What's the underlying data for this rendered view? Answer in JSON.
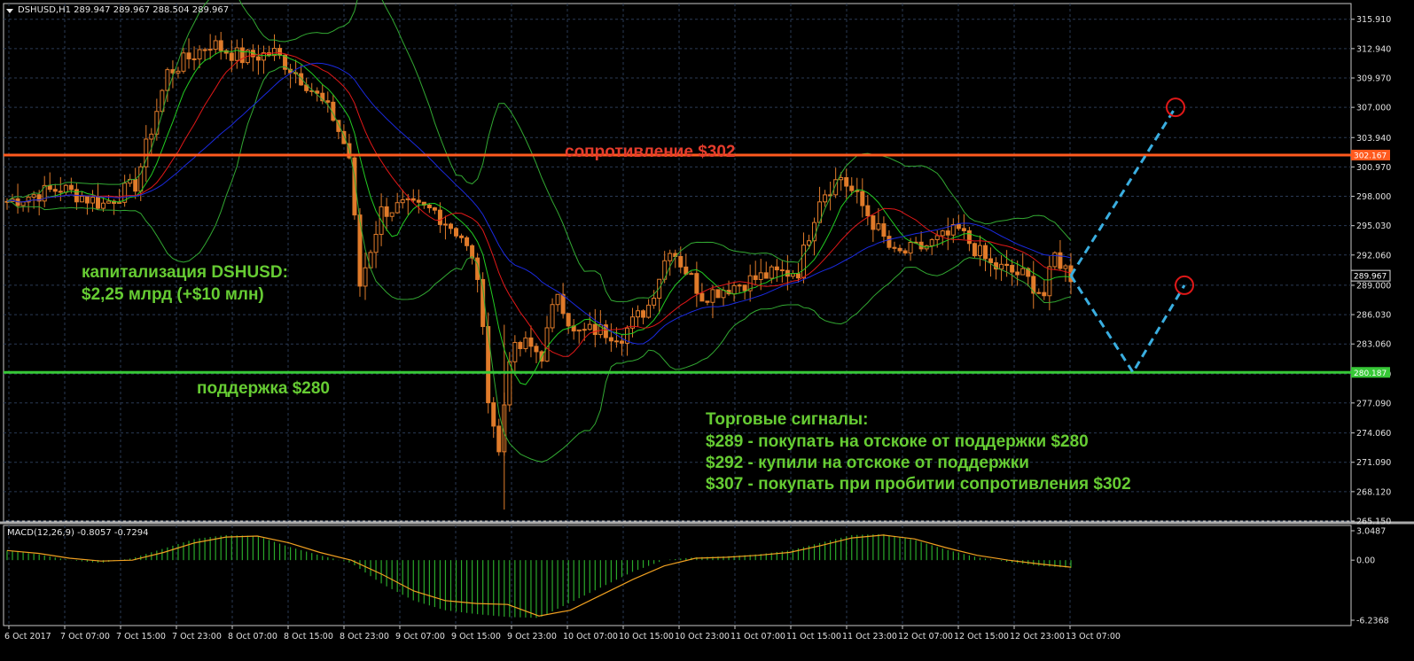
{
  "header": {
    "symbol_line": "DSHUSD,H1  289.947 289.967 288.504 289.967",
    "macd_line": "MACD(12,26,9) -0.8057 -0.7294"
  },
  "colors": {
    "background": "#000000",
    "grid": "#2a3a55",
    "axis": "#c8c8c8",
    "candle": "#e07b2a",
    "resistance": "#ff5a1e",
    "support": "#37c837",
    "annotation_green": "#66cc33",
    "annotation_red": "#e53c2c",
    "bb_band": "#32a832",
    "ma_fast": "#22cc22",
    "ma_mid": "#e01818",
    "ma_slow": "#1a2adf",
    "forecast": "#3aaee0",
    "macd_hist": "#2aa82a",
    "macd_signal": "#f0a020"
  },
  "annotations": {
    "resistance_label": "сопротивление $302",
    "support_label": "поддержка $280",
    "cap_title": "капитализация DSHUSD:",
    "cap_value": "$2,25 млрд (+$10 млн)",
    "signals_title": "Торговые сигналы:",
    "signal_1": "$289 - покупать на отскоке от поддержки $280",
    "signal_2": "$292 - купили на отскоке от поддержки",
    "signal_3": "$307 - покупать при пробитии сопротивления $302"
  },
  "chart_data": [
    {
      "type": "candlestick",
      "symbol": "DSHUSD",
      "timeframe": "H1",
      "ylim": [
        265.15,
        317.5
      ],
      "y_ticks": [
        "315.910",
        "312.940",
        "309.970",
        "307.000",
        "303.940",
        "300.970",
        "298.000",
        "295.030",
        "292.060",
        "289.000",
        "286.030",
        "283.060",
        "280.030",
        "277.090",
        "274.060",
        "271.090",
        "268.120",
        "265.150"
      ],
      "x_ticks": [
        "6 Oct 2017",
        "7 Oct 07:00",
        "7 Oct 15:00",
        "7 Oct 23:00",
        "8 Oct 07:00",
        "8 Oct 15:00",
        "8 Oct 23:00",
        "9 Oct 07:00",
        "9 Oct 15:00",
        "9 Oct 23:00",
        "10 Oct 07:00",
        "10 Oct 15:00",
        "10 Oct 23:00",
        "11 Oct 07:00",
        "11 Oct 15:00",
        "11 Oct 23:00",
        "12 Oct 07:00",
        "12 Oct 15:00",
        "12 Oct 23:00",
        "13 Oct 07:00"
      ],
      "last_price": "289.967",
      "levels": [
        {
          "name": "resistance",
          "value": 302.167,
          "label": "302.167"
        },
        {
          "name": "support",
          "value": 280.187,
          "label": "280.187"
        }
      ],
      "close_path": [
        {
          "bar": 0,
          "price": 297.5
        },
        {
          "bar": 10,
          "price": 298.8
        },
        {
          "bar": 18,
          "price": 297.2
        },
        {
          "bar": 24,
          "price": 299.2
        },
        {
          "bar": 30,
          "price": 310.5
        },
        {
          "bar": 38,
          "price": 313.5
        },
        {
          "bar": 44,
          "price": 312.0
        },
        {
          "bar": 50,
          "price": 312.5
        },
        {
          "bar": 56,
          "price": 309.5
        },
        {
          "bar": 61,
          "price": 306.0
        },
        {
          "bar": 64,
          "price": 302.0
        },
        {
          "bar": 66,
          "price": 289.0
        },
        {
          "bar": 70,
          "price": 296.5
        },
        {
          "bar": 74,
          "price": 297.0
        },
        {
          "bar": 80,
          "price": 296.5
        },
        {
          "bar": 85,
          "price": 294.0
        },
        {
          "bar": 88,
          "price": 290.0
        },
        {
          "bar": 90,
          "price": 278.0
        },
        {
          "bar": 92,
          "price": 272.0
        },
        {
          "bar": 94,
          "price": 282.0
        },
        {
          "bar": 97,
          "price": 283.0
        },
        {
          "bar": 100,
          "price": 282.0
        },
        {
          "bar": 103,
          "price": 288.5
        },
        {
          "bar": 106,
          "price": 284.0
        },
        {
          "bar": 110,
          "price": 284.5
        },
        {
          "bar": 115,
          "price": 284.0
        },
        {
          "bar": 120,
          "price": 287.0
        },
        {
          "bar": 124,
          "price": 293.0
        },
        {
          "bar": 130,
          "price": 288.0
        },
        {
          "bar": 136,
          "price": 289.0
        },
        {
          "bar": 142,
          "price": 290.0
        },
        {
          "bar": 148,
          "price": 290.5
        },
        {
          "bar": 152,
          "price": 298.0
        },
        {
          "bar": 156,
          "price": 300.0
        },
        {
          "bar": 160,
          "price": 297.0
        },
        {
          "bar": 166,
          "price": 292.0
        },
        {
          "bar": 172,
          "price": 293.0
        },
        {
          "bar": 178,
          "price": 294.5
        },
        {
          "bar": 184,
          "price": 291.0
        },
        {
          "bar": 190,
          "price": 290.0
        },
        {
          "bar": 194,
          "price": 288.0
        },
        {
          "bar": 196,
          "price": 292.0
        },
        {
          "bar": 199,
          "price": 289.97
        }
      ],
      "forecast_path": [
        {
          "label": "start",
          "price": 289.97
        },
        {
          "label": "support bounce",
          "price": 280.187
        },
        {
          "label": "target 1",
          "price": 289.0
        }
      ],
      "forecast_branch": [
        {
          "label": "start",
          "price": 289.97
        },
        {
          "label": "target 2",
          "price": 307.0
        }
      ],
      "indicators": [
        "Bollinger Bands",
        "moving average fast",
        "moving average mid",
        "moving average slow"
      ]
    },
    {
      "type": "bar",
      "name": "MACD(12,26,9)",
      "values_latest": {
        "macd": -0.8057,
        "signal": -0.7294
      },
      "ylim": [
        -6.2368,
        3.0487
      ],
      "y_ticks": [
        "3.0487",
        "0.00",
        "-6.2368"
      ],
      "series": [
        {
          "name": "macd_hist",
          "values": [
            1.0,
            0.6,
            0.0,
            -0.3,
            0.2,
            1.2,
            2.2,
            2.6,
            2.5,
            1.4,
            0.5,
            -0.3,
            -2.5,
            -4.2,
            -5.2,
            -5.6,
            -5.9,
            -6.0,
            -4.4,
            -2.8,
            -1.2,
            0.0,
            0.3,
            0.4,
            0.6,
            1.0,
            1.8,
            2.6,
            2.7,
            2.1,
            1.1,
            0.3,
            -0.2,
            -0.6,
            -0.8
          ]
        },
        {
          "name": "signal",
          "values": [
            1.0,
            0.7,
            0.2,
            -0.1,
            0.0,
            0.8,
            1.8,
            2.4,
            2.5,
            1.8,
            0.8,
            0.0,
            -1.5,
            -3.2,
            -4.2,
            -4.5,
            -4.6,
            -5.8,
            -5.2,
            -3.6,
            -2.0,
            -0.6,
            0.2,
            0.3,
            0.5,
            0.8,
            1.5,
            2.3,
            2.6,
            2.2,
            1.3,
            0.5,
            0.0,
            -0.4,
            -0.73
          ]
        }
      ]
    }
  ]
}
